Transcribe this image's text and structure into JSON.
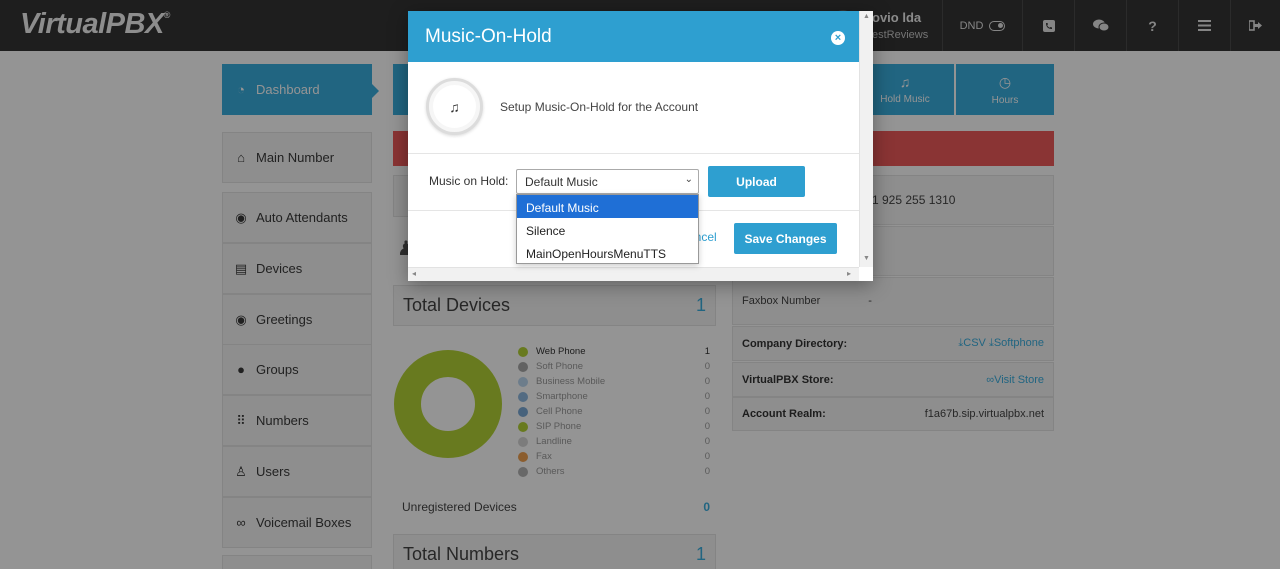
{
  "header": {
    "logo": "VirtualPBX",
    "logo_mark": "®",
    "user_name": "ovio lda",
    "user_company": "estReviews",
    "dnd_label": "DND"
  },
  "sidebar": {
    "items": [
      {
        "label": "Dashboard",
        "icon": "gauge-icon"
      },
      {
        "label": "Main Number",
        "icon": "home-icon"
      },
      {
        "label": "Auto Attendants",
        "icon": "speaker-icon"
      },
      {
        "label": "Devices",
        "icon": "fax-icon"
      },
      {
        "label": "Greetings",
        "icon": "greeting-icon"
      },
      {
        "label": "Groups",
        "icon": "group-icon"
      },
      {
        "label": "Numbers",
        "icon": "grid-icon"
      },
      {
        "label": "Users",
        "icon": "users-icon"
      },
      {
        "label": "Voicemail Boxes",
        "icon": "voicemail-icon"
      }
    ]
  },
  "tiles": {
    "hold_music": "Hold Music",
    "hours": "Hours"
  },
  "account_info": {
    "phone_number": "1 925 255 1310",
    "faxbox_label": "Faxbox Number",
    "faxbox_value": "-",
    "directory_label": "Company Directory:",
    "csv_label": "CSV",
    "softphone_label": "Softphone",
    "store_label": "VirtualPBX Store:",
    "store_link": "Visit Store",
    "realm_label": "Account Realm:",
    "realm_value": "f1a67b.sip.virtualpbx.net"
  },
  "devices_panel": {
    "title": "Total Devices",
    "count": "1",
    "legend": [
      {
        "label": "Web Phone",
        "count": "1",
        "color": "#b3d336"
      },
      {
        "label": "Soft Phone",
        "count": "0",
        "color": "#a9a9a9"
      },
      {
        "label": "Business Mobile",
        "count": "0",
        "color": "#bcd7ef"
      },
      {
        "label": "Smartphone",
        "count": "0",
        "color": "#8fb9e0"
      },
      {
        "label": "Cell Phone",
        "count": "0",
        "color": "#7aa9d6"
      },
      {
        "label": "SIP Phone",
        "count": "0",
        "color": "#b3d336"
      },
      {
        "label": "Landline",
        "count": "0",
        "color": "#d6d6d6"
      },
      {
        "label": "Fax",
        "count": "0",
        "color": "#f0a050"
      },
      {
        "label": "Others",
        "count": "0",
        "color": "#b3b3b3"
      }
    ],
    "unregistered_label": "Unregistered Devices",
    "unregistered_count": "0"
  },
  "numbers_panel": {
    "title": "Total Numbers",
    "count": "1"
  },
  "modal": {
    "title": "Music-On-Hold",
    "close": "×",
    "description": "Setup Music-On-Hold for the Account",
    "field_label": "Music on Hold:",
    "selected_value": "Default Music",
    "upload_label": "Upload",
    "cancel_label": "ancel",
    "save_label": "Save Changes",
    "options": [
      "Default Music",
      "Silence",
      "MainOpenHoursMenuTTS"
    ]
  },
  "colors": {
    "accent": "#3aaedf",
    "alert": "#ee5a5a",
    "topbar": "#353535"
  }
}
